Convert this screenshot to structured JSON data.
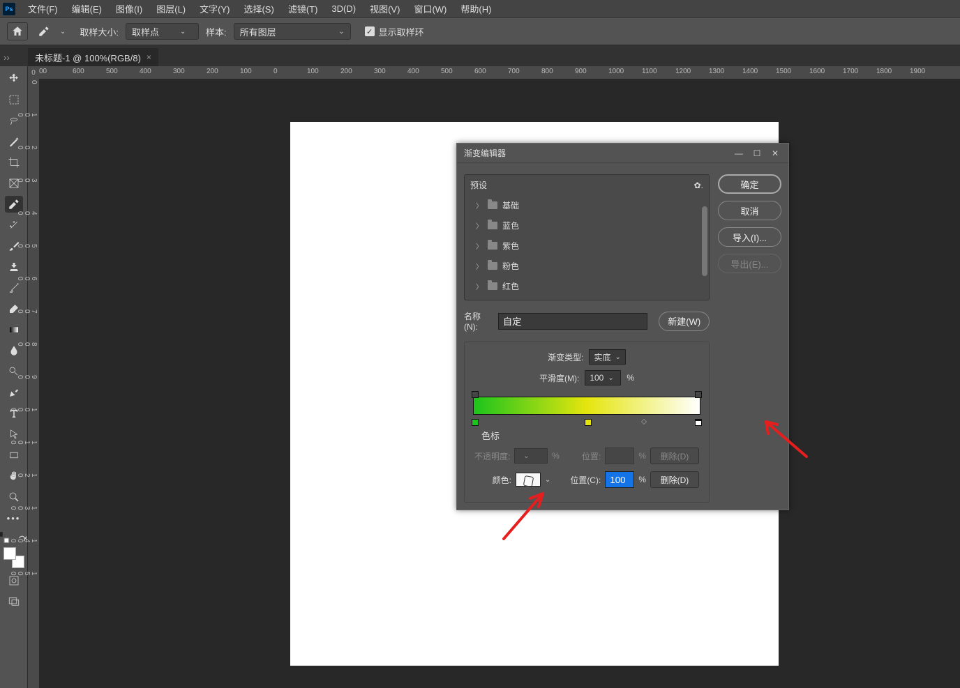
{
  "menu": {
    "items": [
      "文件(F)",
      "编辑(E)",
      "图像(I)",
      "图层(L)",
      "文字(Y)",
      "选择(S)",
      "滤镜(T)",
      "3D(D)",
      "视图(V)",
      "窗口(W)",
      "帮助(H)"
    ],
    "logo": "Ps"
  },
  "optbar": {
    "sample_size_label": "取样大小:",
    "sample_size_value": "取样点",
    "sample_label": "样本:",
    "sample_value": "所有图层",
    "show_ring": "显示取样环"
  },
  "tab": {
    "title": "未标题-1 @ 100%(RGB/8)",
    "close": "×"
  },
  "ruler_h": [
    "00",
    "600",
    "500",
    "400",
    "300",
    "200",
    "100",
    "0",
    "100",
    "200",
    "300",
    "400",
    "500",
    "600",
    "700",
    "800",
    "900",
    "1000",
    "1100",
    "1200",
    "1300",
    "1400",
    "1500",
    "1600",
    "1700",
    "1800",
    "1900"
  ],
  "ruler_corner": "0",
  "ruler_v": [
    "0",
    "100",
    "200",
    "300",
    "400",
    "500",
    "600",
    "700",
    "800",
    "900",
    "1000",
    "1100",
    "1200",
    "1300",
    "1400",
    "1500"
  ],
  "dlg": {
    "title": "渐变编辑器",
    "presets_label": "预设",
    "preset_folders": [
      "基础",
      "蓝色",
      "紫色",
      "粉色",
      "红色"
    ],
    "ok": "确定",
    "cancel": "取消",
    "import": "导入(I)...",
    "export": "导出(E)...",
    "new": "新建(W)",
    "name_label": "名称(N):",
    "name_value": "自定",
    "type_label": "渐变类型:",
    "type_value": "实底",
    "smooth_label": "平滑度(M):",
    "smooth_value": "100",
    "pct": "%",
    "stops_title": "色标",
    "opacity_label": "不透明度:",
    "location_label": "位置:",
    "location_label2": "位置(C):",
    "delete": "删除(D)",
    "color_label": "颜色:",
    "location_value": "100"
  }
}
